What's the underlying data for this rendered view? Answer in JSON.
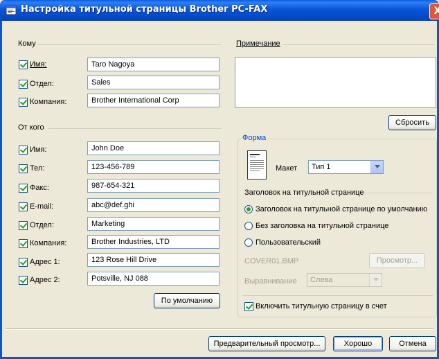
{
  "window": {
    "title": "Настройка титульной страницы Brother PC-FAX",
    "close": "X"
  },
  "to_group": {
    "label": "Кому",
    "rows": [
      {
        "label": "Имя:",
        "value": "Taro Nagoya",
        "checked": true
      },
      {
        "label": "Отдел:",
        "value": "Sales",
        "checked": true
      },
      {
        "label": "Компания:",
        "value": "Brother International Corp",
        "checked": true
      }
    ]
  },
  "from_group": {
    "label": "От кого",
    "rows": [
      {
        "label": "Имя:",
        "value": "John Doe",
        "checked": true
      },
      {
        "label": "Тел:",
        "value": "123-456-789",
        "checked": true
      },
      {
        "label": "Факс:",
        "value": "987-654-321",
        "checked": true
      },
      {
        "label": "E-mail:",
        "value": "abc@def.ghi",
        "checked": true
      },
      {
        "label": "Отдел:",
        "value": "Marketing",
        "checked": true
      },
      {
        "label": "Компания:",
        "value": "Brother Industries, LTD",
        "checked": true
      },
      {
        "label": "Адрес 1:",
        "value": "123 Rose Hill Drive",
        "checked": true
      },
      {
        "label": "Адрес 2:",
        "value": "Potsville, NJ 088",
        "checked": true
      }
    ],
    "default_button": "По умолчанию"
  },
  "note_group": {
    "label": "Примечание",
    "reset_button": "Сбросить"
  },
  "form_group": {
    "label": "Форма",
    "layout_label": "Макет",
    "layout_value": "Тип 1",
    "header_label": "Заголовок на титульной странице",
    "radios": [
      {
        "label": "Заголовок на титульной странице по умолчанию",
        "selected": true
      },
      {
        "label": "Без заголовка на титульной странице",
        "selected": false
      },
      {
        "label": "Пользовательский",
        "selected": false
      }
    ],
    "file_name": "COVER01.BMP",
    "browse_button": "Просмотр...",
    "align_label": "Выравнивание",
    "align_value": "Слева",
    "include_cover": "Включить титульную страницу в счет"
  },
  "footer": {
    "preview_button": "Предварительный просмотр...",
    "ok_button": "Хорошо",
    "cancel_button": "Отмена"
  },
  "colors": {
    "title_bar": "#0a55d8",
    "dialog_bg": "#ece9d8",
    "check_mark": "#21a121",
    "field_border": "#7f9db9"
  }
}
